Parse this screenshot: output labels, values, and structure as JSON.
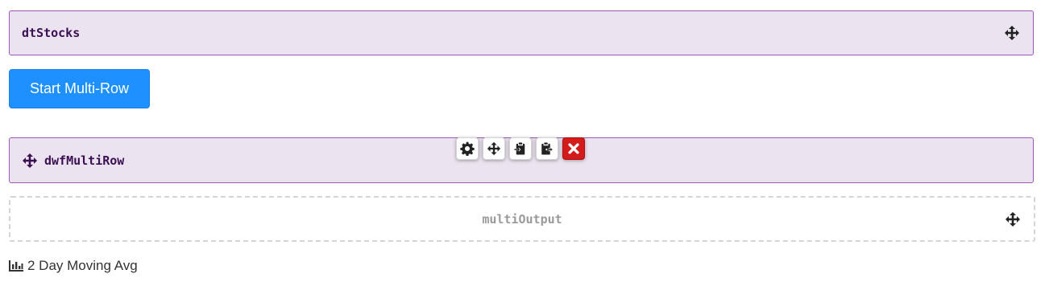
{
  "panels": {
    "dtStocks": {
      "label": "dtStocks"
    },
    "dwfMultiRow": {
      "label": "dwfMultiRow"
    },
    "multiOutput": {
      "label": "multiOutput"
    }
  },
  "buttons": {
    "start_multi_row": "Start Multi-Row"
  },
  "toolbar": {
    "items": [
      {
        "icon": "gear-icon",
        "title": "settings"
      },
      {
        "icon": "move-icon",
        "title": "move"
      },
      {
        "icon": "paste-icon",
        "title": "paste"
      },
      {
        "icon": "clipboard-export-icon",
        "title": "copy"
      },
      {
        "icon": "close-icon",
        "title": "remove"
      }
    ]
  },
  "footer": {
    "icon": "bar-chart-icon",
    "label": "2 Day Moving Avg"
  },
  "colors": {
    "panel_bg": "#ebe3ef",
    "panel_border": "#9b59b6",
    "label_text": "#3b1053",
    "primary": "#1e90ff",
    "danger": "#d31b1b",
    "placeholder_text": "#9a9a9a"
  }
}
